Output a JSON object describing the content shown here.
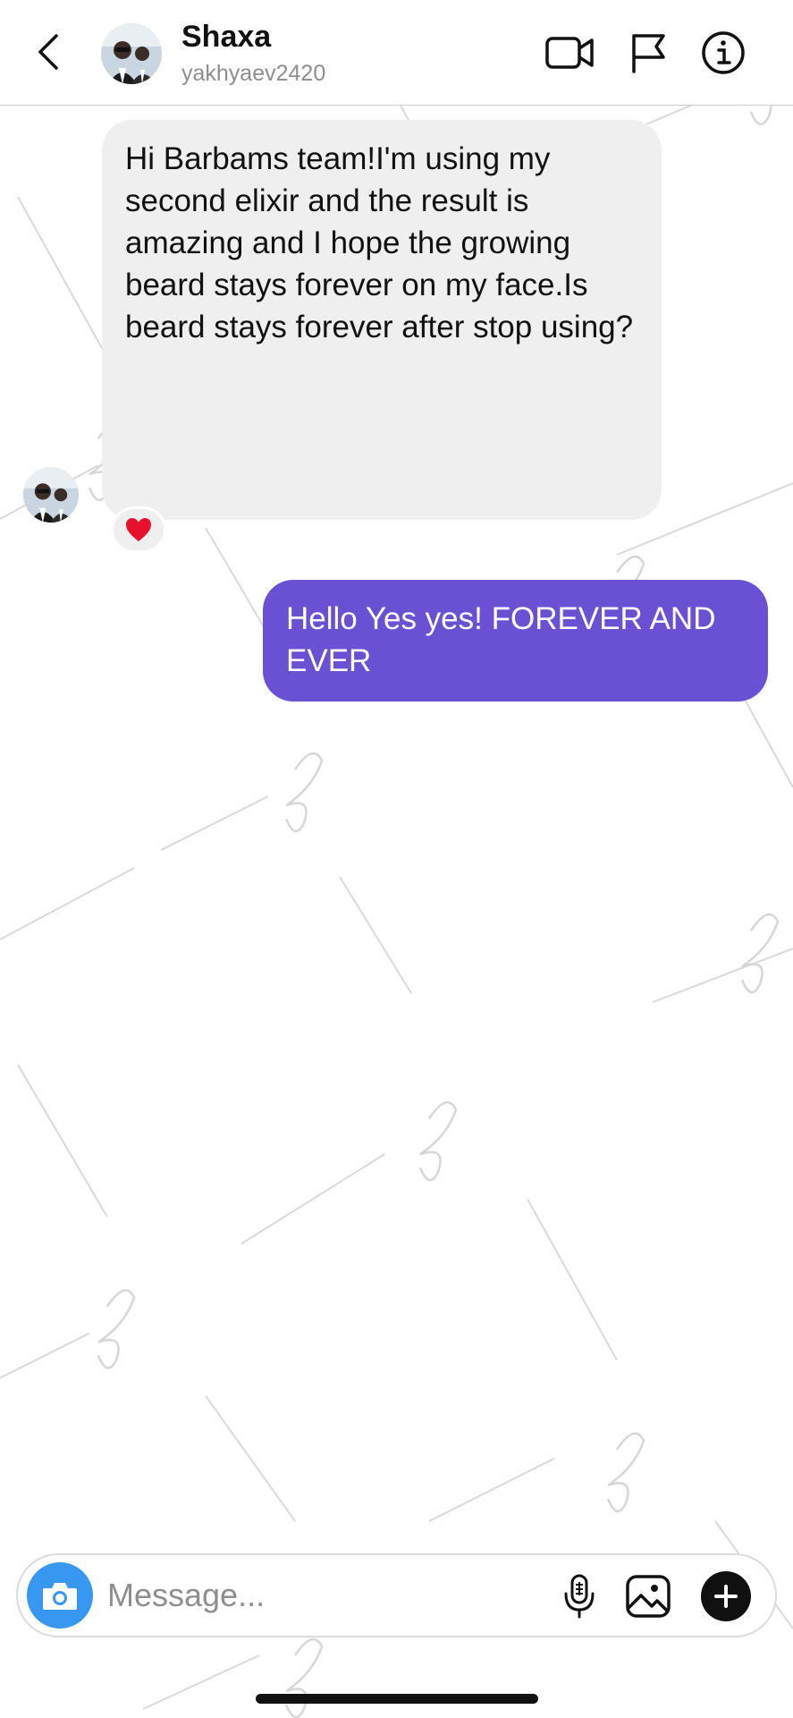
{
  "header": {
    "name": "Shaxa",
    "handle": "yakhyaev2420",
    "icons": [
      "back-chevron-icon",
      "video-call-icon",
      "flag-icon",
      "info-icon"
    ]
  },
  "messages": [
    {
      "direction": "incoming",
      "text": "Hi Barbams team!I'm using my second elixir and the result is amazing and I hope the growing beard stays forever on my face.Is beard stays forever after stop using?",
      "reaction": "heart"
    },
    {
      "direction": "outgoing",
      "text": "Hello Yes yes! FOREVER AND EVER"
    }
  ],
  "composer": {
    "placeholder": "Message...",
    "icons": [
      "camera-icon",
      "microphone-icon",
      "gallery-icon",
      "plus-icon"
    ]
  },
  "colors": {
    "outgoing_bubble": "#6a50d3",
    "incoming_bubble": "#efefef",
    "camera_button": "#3897f0",
    "reaction_heart": "#e8112d"
  }
}
